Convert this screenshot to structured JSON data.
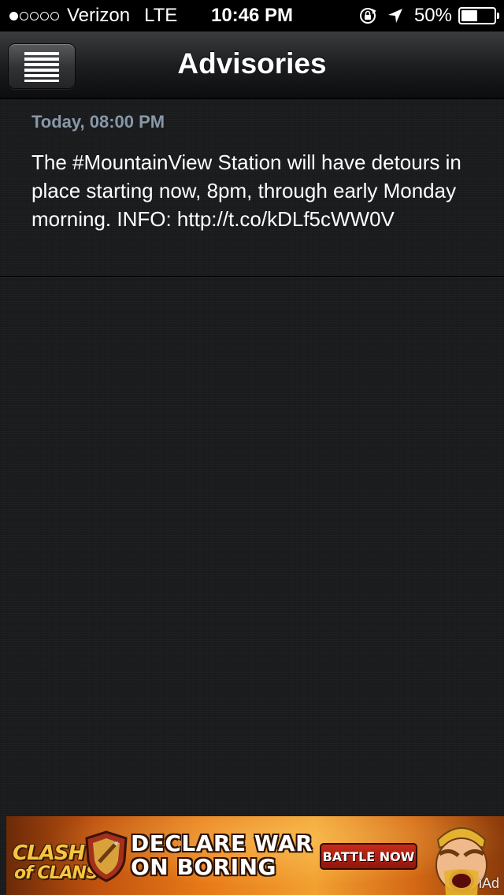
{
  "status_bar": {
    "signal_filled": 1,
    "signal_total": 5,
    "carrier": "Verizon",
    "network": "LTE",
    "time": "10:46 PM",
    "battery_percent": "50%",
    "battery_level": 0.5,
    "icons": [
      "rotation-lock-icon",
      "location-arrow-icon",
      "battery-icon"
    ]
  },
  "nav": {
    "title": "Advisories",
    "menu_icon": "hamburger-menu-icon"
  },
  "advisories": [
    {
      "date": "Today, 08:00 PM",
      "text": "The #MountainView Station will have detours in place starting now, 8pm, through early Monday morning. INFO: http://t.co/kDLf5cWW0V"
    }
  ],
  "ad": {
    "logo_line_1": "CLASH",
    "logo_line_2": "of CLANS",
    "headline_1": "DECLARE WAR",
    "headline_2": "ON BORING",
    "cta": "BATTLE NOW",
    "tag": "iAd"
  },
  "colors": {
    "background": "#1b1c1e",
    "date_text": "#8898a8",
    "body_text": "#ffffff",
    "cta_red": "#c62b1a"
  }
}
